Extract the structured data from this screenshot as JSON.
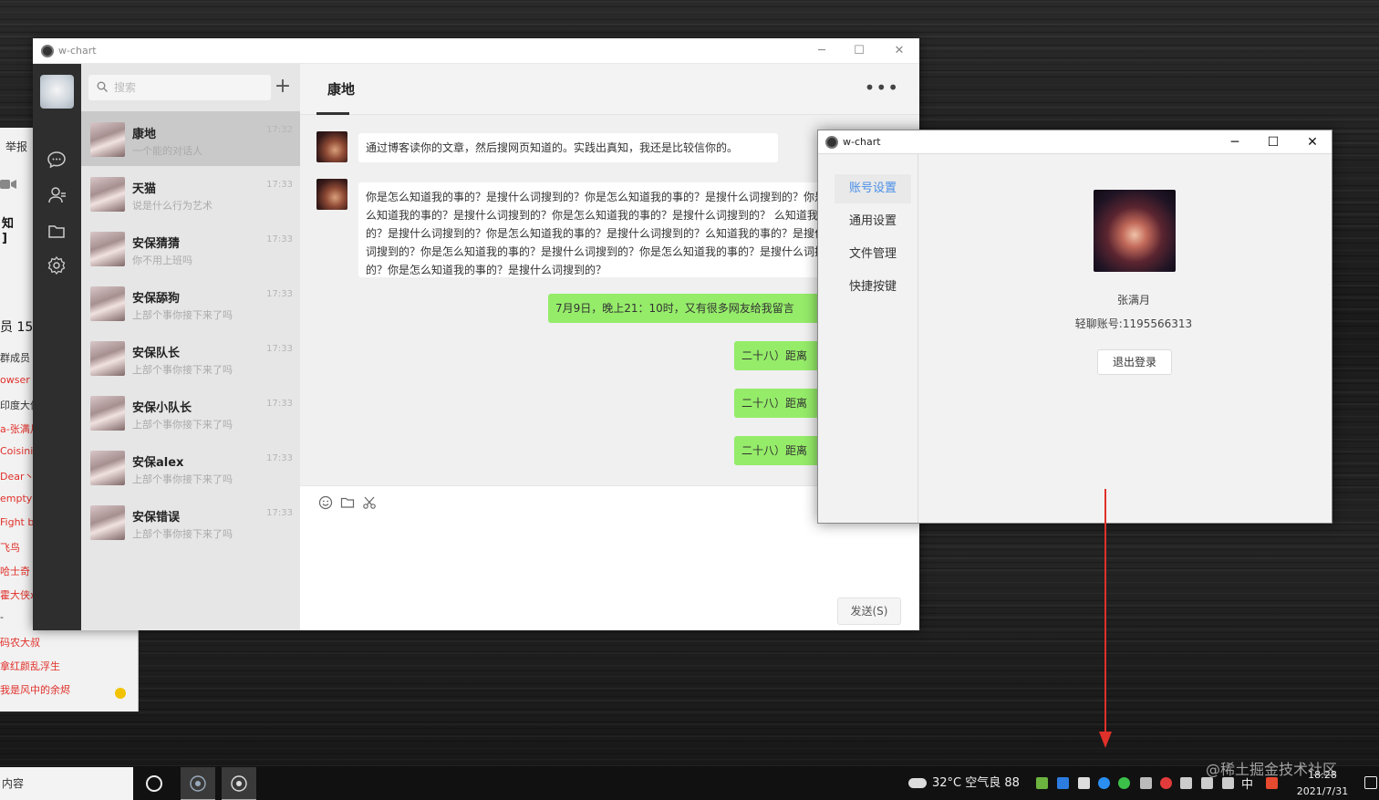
{
  "background_window": {
    "report_label": "举报",
    "zhi": "知",
    "bracket": "]",
    "members_label": "员 15",
    "lines": [
      {
        "text": "群成员",
        "color": "dark"
      },
      {
        "text": "owser",
        "color": "red"
      },
      {
        "text": "印度大侠",
        "color": "dark"
      },
      {
        "text": "a-张满月",
        "color": "red"
      },
      {
        "text": "Coisini",
        "color": "red"
      },
      {
        "text": "Dear丶",
        "color": "red"
      },
      {
        "text": "empty",
        "color": "red"
      },
      {
        "text": "Fight b",
        "color": "red"
      },
      {
        "text": "飞鸟",
        "color": "red"
      },
      {
        "text": "哈士奇",
        "color": "red"
      },
      {
        "text": "霍大侠x",
        "color": "red"
      },
      {
        "text": "-",
        "color": "dark"
      },
      {
        "text": "码农大叔",
        "color": "red"
      },
      {
        "text": "拿红颜乱浮生",
        "color": "red"
      },
      {
        "text": "我是风中的余烬",
        "color": "red"
      }
    ]
  },
  "main_window": {
    "title": "w-chart",
    "controls": {
      "minimize": "─",
      "maximize": "☐",
      "close": "✕"
    },
    "search": {
      "placeholder": "搜索"
    },
    "add_label": "+",
    "contacts": [
      {
        "name": "康地",
        "preview": "一个能的对话人",
        "time": "17:32",
        "active": true
      },
      {
        "name": "天猫",
        "preview": "说是什么行为艺术",
        "time": "17:33",
        "active": false
      },
      {
        "name": "安保猜猜",
        "preview": "你不用上班吗",
        "time": "17:33",
        "active": false
      },
      {
        "name": "安保舔狗",
        "preview": "上部个事你接下来了吗",
        "time": "17:33",
        "active": false
      },
      {
        "name": "安保队长",
        "preview": "上部个事你接下来了吗",
        "time": "17:33",
        "active": false
      },
      {
        "name": "安保小队长",
        "preview": "上部个事你接下来了吗",
        "time": "17:33",
        "active": false
      },
      {
        "name": "安保alex",
        "preview": "上部个事你接下来了吗",
        "time": "17:33",
        "active": false
      },
      {
        "name": "安保错误",
        "preview": "上部个事你接下来了吗",
        "time": "17:33",
        "active": false
      }
    ],
    "chat": {
      "title": "康地",
      "more_label": "•••",
      "messages_left": [
        "通过博客读你的文章，然后搜网页知道的。实践出真知，我还是比较信你的。",
        "你是怎么知道我的事的？是搜什么词搜到的？你是怎么知道我的事的？是搜什么词搜到的？你是怎么知道我的事的？是搜什么词搜到的？你是怎么知道我的事的？是搜什么词搜到的？ 么知道我的事的？是搜什么词搜到的？你是怎么知道我的事的？是搜什么词搜到的？么知道我的事的？是搜什么词搜到的？你是怎么知道我的事的？是搜什么词搜到的？你是怎么知道我的事的？是搜什么词搜到的？你是怎么知道我的事的？是搜什么词搜到的？"
      ],
      "messages_right": [
        "7月9日，晚上21：10时，又有很多网友给我留言",
        "二十八）距离",
        "二十八）距离",
        "二十八）距离"
      ],
      "send_label": "发送(S)"
    }
  },
  "settings_window": {
    "title": "w-chart",
    "controls": {
      "minimize": "─",
      "maximize": "☐",
      "close": "✕"
    },
    "menu": [
      {
        "label": "账号设置",
        "active": true
      },
      {
        "label": "通用设置",
        "active": false
      },
      {
        "label": "文件管理",
        "active": false
      },
      {
        "label": "快捷按键",
        "active": false
      }
    ],
    "user_name": "张满月",
    "account": "轻聊账号:1195566313",
    "logout_label": "退出登录"
  },
  "taskbar": {
    "search_text": "内容",
    "weather": "32°C 空气良 88",
    "ime": "中",
    "time": "18:28",
    "date": "2021/7/31"
  },
  "watermark": "@稀土掘金技术社区",
  "colors": {
    "accent_blue": "#4a8fe7",
    "bubble_green": "#95ec69",
    "annotation_red": "#e0302a"
  }
}
